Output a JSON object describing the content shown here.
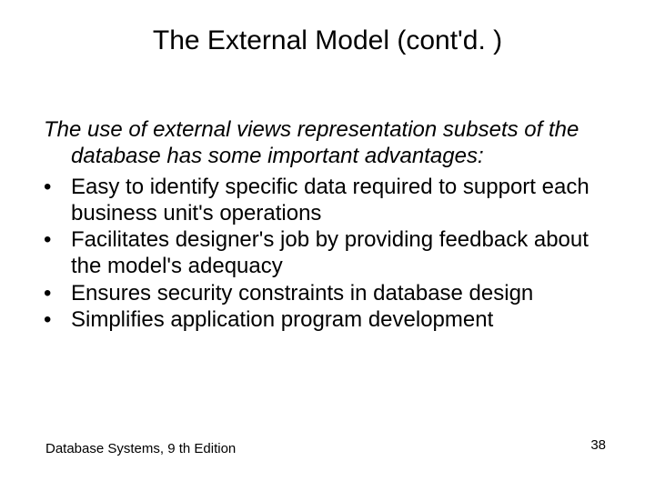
{
  "title": "The External Model (cont'd. )",
  "intro": "The use of external views representation subsets of the database has some important advantages:",
  "bullets": [
    "Easy to identify specific data required to support each business unit's operations",
    "Facilitates designer's job by providing feedback about the model's adequacy",
    "Ensures security constraints in database design",
    "Simplifies application program development"
  ],
  "footer_left": "Database Systems, 9 th Edition",
  "page_number": "38"
}
